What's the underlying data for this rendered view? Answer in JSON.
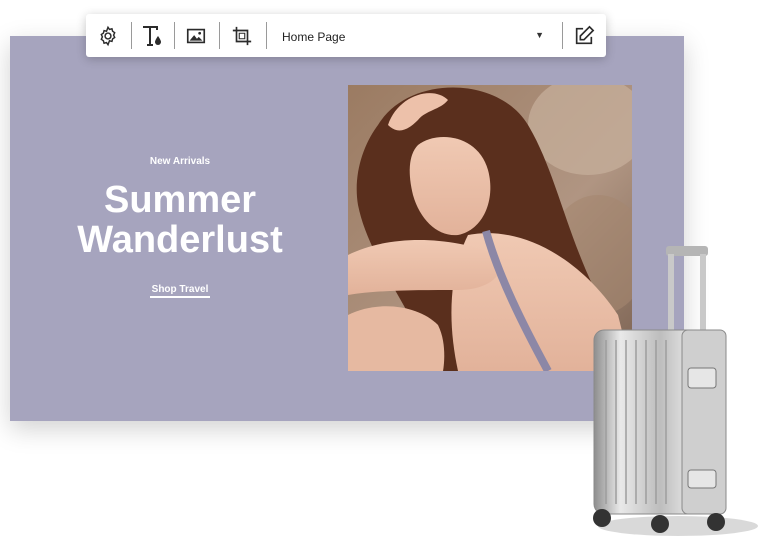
{
  "toolbar": {
    "icons": [
      "gear-icon",
      "text-style-icon",
      "image-icon",
      "crop-icon",
      "edit-icon"
    ],
    "page_select": {
      "value": "Home Page"
    }
  },
  "banner": {
    "kicker": "New Arrivals",
    "headline": "Summer Wanderlust",
    "cta": "Shop Travel",
    "background": "#a6a4be",
    "text_color": "#ffffff"
  }
}
